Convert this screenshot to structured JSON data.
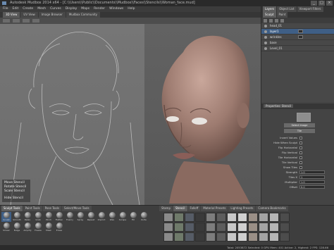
{
  "window": {
    "title": "Autodesk Mudbox 2014 x64 - [C:\\\\Users\\\\Public\\\\Documents\\\\Mudbox\\\\Faces\\\\Stencils\\\\Woman_face.mud]"
  },
  "menu": [
    "File",
    "Edit",
    "Create",
    "Mesh",
    "Curves",
    "Display",
    "Maps",
    "Render",
    "Windows",
    "Help"
  ],
  "viewport_tabs": [
    "3D View",
    "UV View",
    "Image Browser",
    "Mudbox Community"
  ],
  "stencil_menu": {
    "move": "Move Stencil",
    "rotate": "Rotate Stencil",
    "scale": "Scale Stencil",
    "hide": "Hide Stencil"
  },
  "side_panel": {
    "tabs": [
      "Layers",
      "Object List",
      "Viewport Filters"
    ],
    "layer_tabs": [
      "Sculpt",
      "Paint"
    ],
    "layers": [
      {
        "name": "head_01",
        "selected": false
      },
      {
        "name": "layer1",
        "selected": true
      },
      {
        "name": "wrinkles",
        "selected": false
      },
      {
        "name": "base",
        "selected": false
      },
      {
        "name": "Level_01",
        "selected": false
      }
    ],
    "props_header": "Properties: Stencil",
    "props": {
      "select_btn": "Select Image",
      "tile_btn": "Tile",
      "invert_label": "Invert Values",
      "hide_brush_label": "Hide When Sculpt",
      "flip_h_label": "Flip Horizontal",
      "flip_v_label": "Flip Vertical",
      "tile_horizontal_label": "Tile Horizontal",
      "tile_vertical_label": "Tile Vertical",
      "show_tiles_label": "Show Tiles",
      "strength_label": "Strength",
      "strength_value": "1.0",
      "tiles_label": "Tiles X",
      "tiles_value": "1",
      "multiplier_label": "Multiplier",
      "multiplier_value": "1.0",
      "offset_label": "Offset",
      "offset_value": "0.0"
    }
  },
  "tray": {
    "tabs": [
      "Sculpt Tools",
      "Paint Tools",
      "Pose Tools",
      "Select/Move Tools"
    ],
    "brushes": [
      "Sculpt",
      "Smooth",
      "Relax",
      "Grab",
      "Pinch",
      "Flatten",
      "Foamy",
      "Spray",
      "Repeat",
      "Imprint",
      "Wax",
      "Scrape",
      "Fill",
      "Knife",
      "Smear",
      "Bulge",
      "Amplify",
      "Freeze",
      "Mask",
      "Erase"
    ],
    "stamp_tabs": [
      "Stamp",
      "Stencil",
      "Falloff",
      "Material Presets",
      "Lighting Presets",
      "Camera Bookmarks"
    ]
  },
  "status": {
    "text": "Total: 2053872 Selected: 0 GPU Mem: 401 Active: 2, Highest: 2 FPS: 128.66"
  }
}
